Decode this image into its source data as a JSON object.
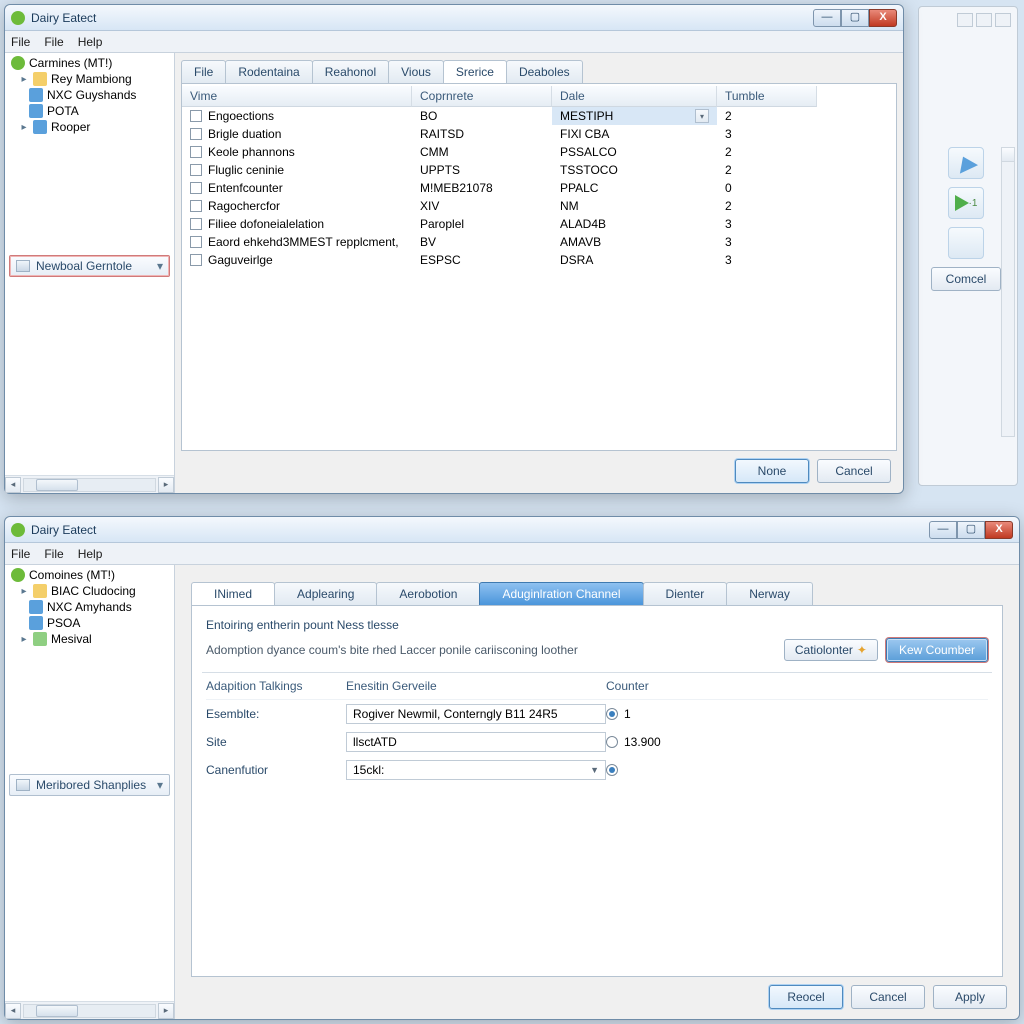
{
  "window1": {
    "title": "Dairy Eatect",
    "menus": [
      "File",
      "File",
      "Help"
    ],
    "tree_root": "Carmines (MT!)",
    "tree_items": [
      "Rey Mambiong",
      "NXC Guyshands",
      "POTA",
      "Rooper"
    ],
    "side_dropdown": "Newboal Gerntole",
    "tabs": [
      "File",
      "Rodentaina",
      "Reahonol",
      "Vious",
      "Srerice",
      "Deaboles"
    ],
    "active_tab": 4,
    "columns": [
      "Vime",
      "Coprnrete",
      "Dale",
      "Tumble"
    ],
    "rows": [
      {
        "name": "Engoections",
        "cop": "BO",
        "dale": "MESTIPH",
        "tum": "2",
        "sel": true
      },
      {
        "name": "Brigle duation",
        "cop": "RAITSD",
        "dale": "FIXl CBA",
        "tum": "3"
      },
      {
        "name": "Keole phannons",
        "cop": "CMM",
        "dale": "PSSALCO",
        "tum": "2"
      },
      {
        "name": "Fluglic ceninie",
        "cop": "UPPTS",
        "dale": "TSSTOCO",
        "tum": "2"
      },
      {
        "name": "Entenfcounter",
        "cop": "M!MEB21078",
        "dale": "PPALC",
        "tum": "0"
      },
      {
        "name": "Ragochercfor",
        "cop": "XIV",
        "dale": "NM",
        "tum": "2"
      },
      {
        "name": "Filiee dofoneialelation",
        "cop": "Paroplel",
        "dale": "ALAD4B",
        "tum": "3"
      },
      {
        "name": "Eaord ehkehd3MMEST repplcment,",
        "cop": "BV",
        "dale": "AMAVB",
        "tum": "3"
      },
      {
        "name": "Gaguveirlge",
        "cop": "ESPSC",
        "dale": "DSRA",
        "tum": "3"
      }
    ],
    "buttons": {
      "primary": "None",
      "cancel": "Cancel"
    }
  },
  "bgwin": {
    "cancel": "Comcel"
  },
  "window2": {
    "title": "Dairy Eatect",
    "menus": [
      "File",
      "File",
      "Help"
    ],
    "tree_root": "Comoines (MT!)",
    "tree_items": [
      "BIAC Cludocing",
      "NXC Amyhands",
      "PSOA",
      "Mesival"
    ],
    "side_dropdown": "Meribored Shanplies",
    "tabs": [
      "INimed",
      "Adplearing",
      "Aerobotion",
      "Aduginlration Channel",
      "Dienter",
      "Nerway"
    ],
    "active_tab": 3,
    "heading": "Entoiring entherin pount Ness tlesse",
    "subtext": "Adomption dyance coum's bite rhed Laccer ponile cariisconing loother",
    "btn_cat": "Catiolonter",
    "btn_kew": "Kew Coumber",
    "col_headers": [
      "Adapition Talkings",
      "Enesitin Gerveile",
      "Counter"
    ],
    "rows": [
      {
        "lbl": "Esemblte:",
        "val": "Rogiver Newmil, Conterngly B11 24R5",
        "radio": "1",
        "on": true
      },
      {
        "lbl": "Site",
        "val": "llsctATD",
        "radio": "13.900",
        "on": false
      },
      {
        "lbl": "Canenfutior",
        "val": "15ckl:",
        "radio": "",
        "on": true,
        "select": true
      }
    ],
    "buttons": {
      "primary": "Reocel",
      "cancel": "Cancel",
      "apply": "Apply"
    }
  }
}
